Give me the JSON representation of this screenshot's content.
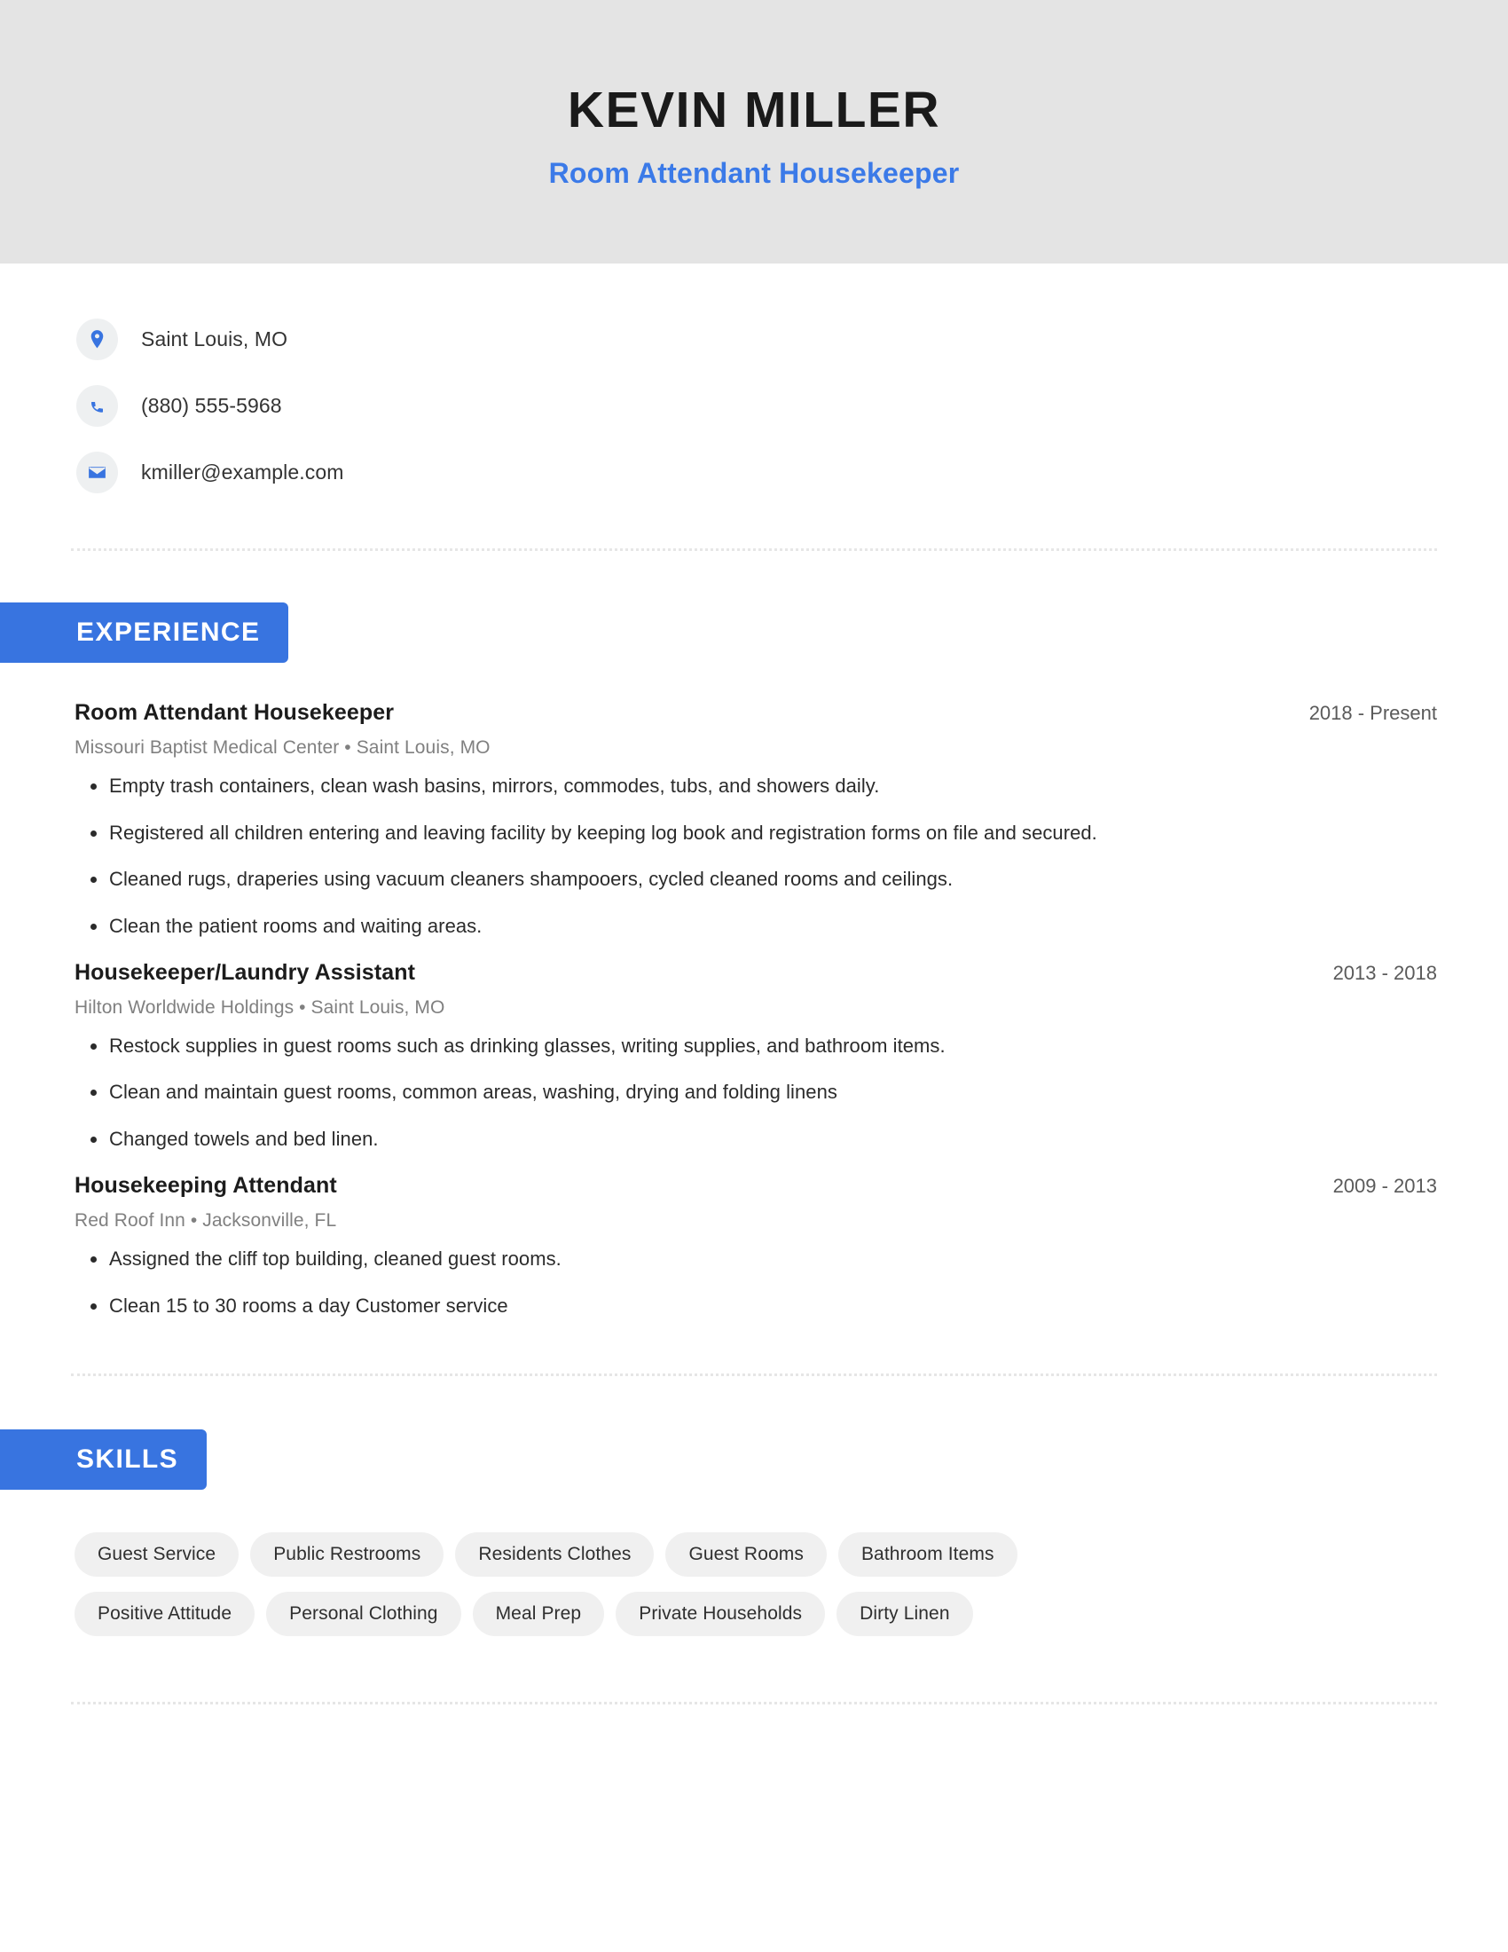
{
  "theme": {
    "accent": "#3874e0",
    "subtitle_color": "#3b7ae8",
    "header_bg": "#e4e4e4",
    "pill_bg": "#f0f0f0",
    "page_bg": "#ffffff"
  },
  "header": {
    "name": "KEVIN MILLER",
    "subtitle": "Room Attendant Housekeeper"
  },
  "contact": {
    "items": [
      {
        "icon": "location-pin-icon",
        "text": "Saint Louis, MO"
      },
      {
        "icon": "phone-icon",
        "text": "(880) 555-5968"
      },
      {
        "icon": "envelope-icon",
        "text": "kmiller@example.com"
      }
    ]
  },
  "sections": {
    "experience": {
      "label": "EXPERIENCE",
      "jobs": [
        {
          "title": "Room Attendant Housekeeper",
          "date": "2018 - Present",
          "meta": "Missouri Baptist Medical Center • Saint Louis, MO",
          "bullets": [
            "Empty trash containers, clean wash basins, mirrors, commodes, tubs, and showers daily.",
            "Registered all children entering and leaving facility by keeping log book and registration forms on file and secured.",
            "Cleaned rugs, draperies using vacuum cleaners shampooers, cycled cleaned rooms and ceilings.",
            "Clean the patient rooms and waiting areas."
          ]
        },
        {
          "title": "Housekeeper/Laundry Assistant",
          "date": "2013 - 2018",
          "meta": "Hilton Worldwide Holdings • Saint Louis, MO",
          "bullets": [
            "Restock supplies in guest rooms such as drinking glasses, writing supplies, and bathroom items.",
            "Clean and maintain guest rooms, common areas, washing, drying and folding linens",
            "Changed towels and bed linen."
          ]
        },
        {
          "title": "Housekeeping Attendant",
          "date": "2009 - 2013",
          "meta": "Red Roof Inn • Jacksonville, FL",
          "bullets": [
            "Assigned the cliff top building, cleaned guest rooms.",
            "Clean 15 to 30 rooms a day Customer service"
          ]
        }
      ]
    },
    "skills": {
      "label": "SKILLS",
      "items": [
        "Guest Service",
        "Public Restrooms",
        "Residents Clothes",
        "Guest Rooms",
        "Bathroom Items",
        "Positive Attitude",
        "Personal Clothing",
        "Meal Prep",
        "Private Households",
        "Dirty Linen"
      ]
    }
  }
}
